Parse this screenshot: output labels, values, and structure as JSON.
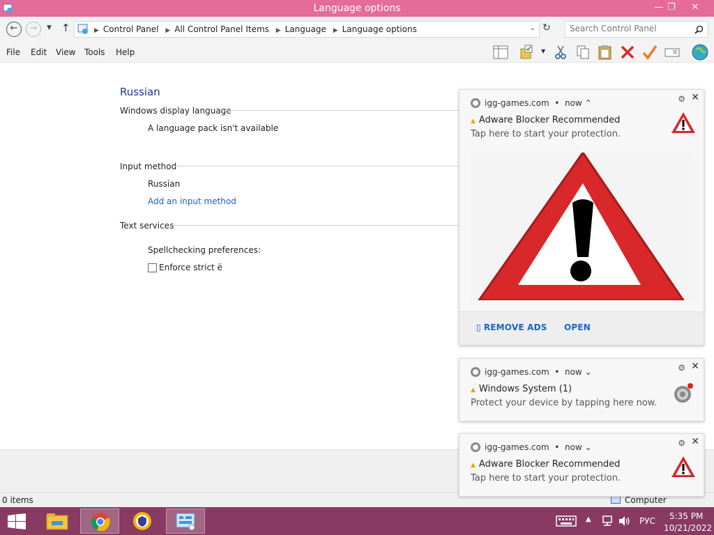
{
  "window": {
    "title": "Language options",
    "minimize": "—",
    "maximize": "❐",
    "close": "✕"
  },
  "address": {
    "crumbs": [
      "Control Panel",
      "All Control Panel Items",
      "Language",
      "Language options"
    ],
    "search_placeholder": "Search Control Panel"
  },
  "menu": [
    "File",
    "Edit",
    "View",
    "Tools",
    "Help"
  ],
  "content": {
    "language": "Russian",
    "display_section": "Windows display language",
    "display_value": "A language pack isn't available",
    "input_section": "Input method",
    "input_value": "Russian",
    "add_input": "Add an input method",
    "text_section": "Text services",
    "spell_label": "Spellchecking preferences:",
    "enforce_label": "Enforce strict ё"
  },
  "notifications": [
    {
      "source": "igg-games.com",
      "time": "now",
      "chevron": "⌃",
      "title": "Adware Blocker Recommended",
      "body": "Tap here to start your protection.",
      "action1": "REMOVE ADS",
      "action2": "OPEN"
    },
    {
      "source": "igg-games.com",
      "time": "now",
      "chevron": "⌄",
      "title": "Windows System (1)",
      "body": "Protect your device by tapping here now."
    },
    {
      "source": "igg-games.com",
      "time": "now",
      "chevron": "⌄",
      "title": "Adware Blocker Recommended",
      "body": "Tap here to start your protection."
    }
  ],
  "status": {
    "items": "0 items",
    "computer": "Computer"
  },
  "taskbar": {
    "lang": "РУС",
    "time": "5:35 PM",
    "date": "10/21/2022"
  },
  "colors": {
    "titlebar": "#e56b98",
    "taskbar": "#883a62",
    "link": "#1b64c2",
    "heading": "#1e3287",
    "warning_red": "#d8282a"
  },
  "icons": [
    "control-panel-icon",
    "back-arrow-icon",
    "forward-arrow-icon",
    "up-arrow-icon",
    "refresh-icon",
    "search-icon",
    "gear-icon",
    "close-icon",
    "warning-triangle-icon",
    "chrome-icon",
    "windows-start-icon",
    "file-explorer-icon",
    "keyboard-icon",
    "network-icon",
    "speaker-icon"
  ]
}
